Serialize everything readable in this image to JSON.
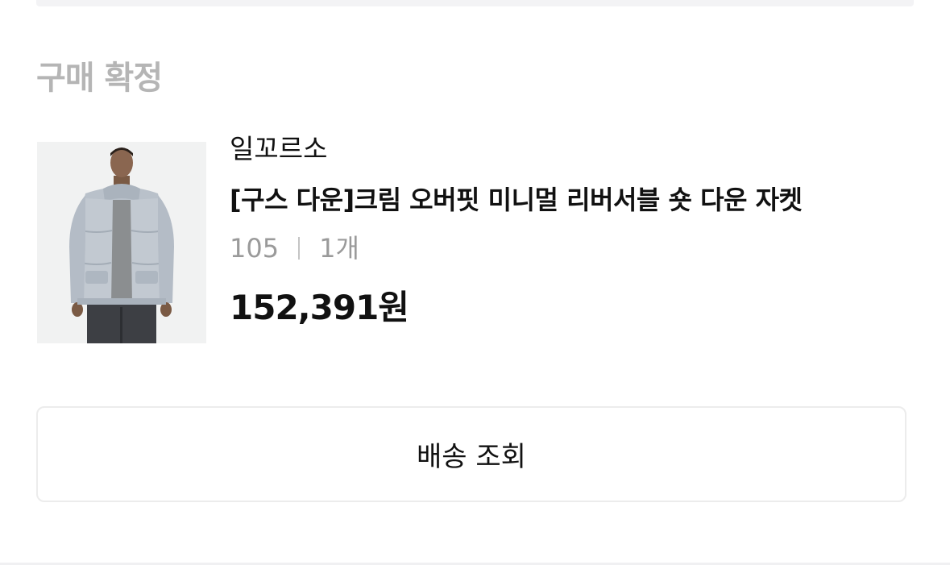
{
  "order": {
    "status_title": "구매 확정",
    "item": {
      "brand": "일꼬르소",
      "product_name": "[구스 다운]크림 오버핏 미니멀 리버서블 숏 다운 자켓",
      "size": "105",
      "quantity": "1개",
      "price": "152,391원",
      "image": "product-photo-man-wearing-light-blue-down-jacket"
    },
    "tracking_button_label": "배송 조회"
  },
  "colors": {
    "status_title": "#b5b5b5",
    "text_primary": "#111111",
    "text_secondary": "#9a9a9a",
    "border": "#ececec"
  }
}
